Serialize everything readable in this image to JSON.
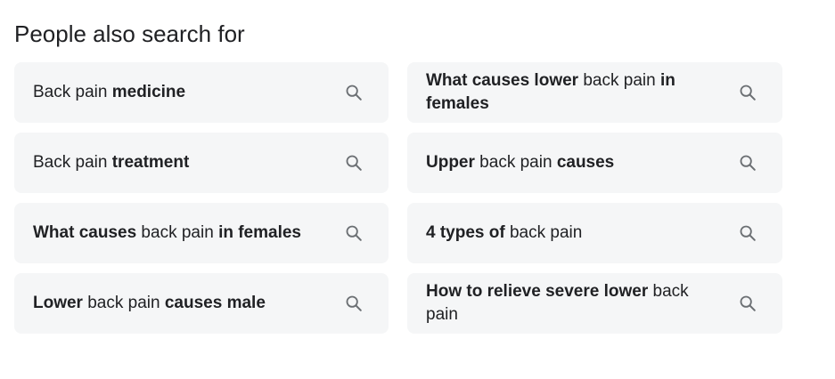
{
  "heading": "People also search for",
  "icon": "search-icon",
  "icon_color": "#6b6f73",
  "chip_background": "#f5f6f7",
  "items": [
    {
      "segments": [
        {
          "text": "Back pain ",
          "bold": false
        },
        {
          "text": "medicine",
          "bold": true
        }
      ]
    },
    {
      "segments": [
        {
          "text": "What causes lower",
          "bold": true
        },
        {
          "text": " back pain ",
          "bold": false
        },
        {
          "text": "in females",
          "bold": true
        }
      ]
    },
    {
      "segments": [
        {
          "text": "Back pain ",
          "bold": false
        },
        {
          "text": "treatment",
          "bold": true
        }
      ]
    },
    {
      "segments": [
        {
          "text": "Upper",
          "bold": true
        },
        {
          "text": " back pain ",
          "bold": false
        },
        {
          "text": "causes",
          "bold": true
        }
      ]
    },
    {
      "segments": [
        {
          "text": "What causes",
          "bold": true
        },
        {
          "text": " back pain ",
          "bold": false
        },
        {
          "text": "in females",
          "bold": true
        }
      ]
    },
    {
      "segments": [
        {
          "text": "4 types of",
          "bold": true
        },
        {
          "text": " back pain",
          "bold": false
        }
      ]
    },
    {
      "segments": [
        {
          "text": "Lower",
          "bold": true
        },
        {
          "text": " back pain ",
          "bold": false
        },
        {
          "text": "causes male",
          "bold": true
        }
      ]
    },
    {
      "segments": [
        {
          "text": "How to relieve severe lower",
          "bold": true
        },
        {
          "text": " back pain",
          "bold": false
        }
      ]
    }
  ]
}
